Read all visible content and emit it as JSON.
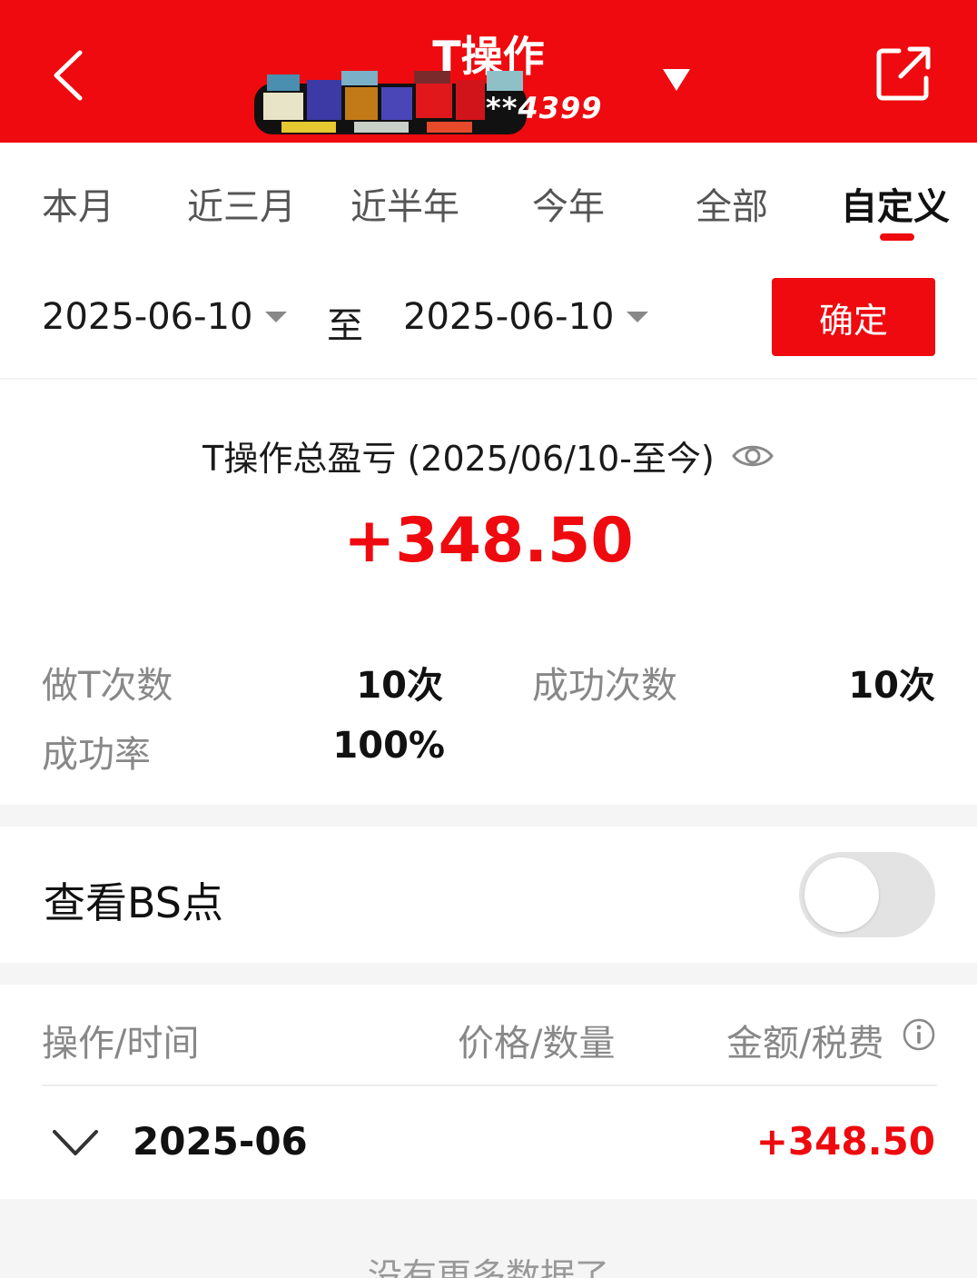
{
  "header": {
    "title": "T操作",
    "account_masked": "**4399"
  },
  "colors": {
    "brand_red": "#ee0a0f",
    "label_gray": "#888888"
  },
  "tabs": [
    {
      "label": "本月",
      "active": false
    },
    {
      "label": "近三月",
      "active": false
    },
    {
      "label": "近半年",
      "active": false
    },
    {
      "label": "今年",
      "active": false
    },
    {
      "label": "全部",
      "active": false
    },
    {
      "label": "自定义",
      "active": true
    }
  ],
  "date_range": {
    "start": "2025-06-10",
    "to_label": "至",
    "end": "2025-06-10",
    "confirm_label": "确定"
  },
  "summary": {
    "title": "T操作总盈亏 (2025/06/10-至今)",
    "total": "+348.50",
    "stats": {
      "trades_label": "做T次数",
      "trades_value": "10次",
      "success_label": "成功次数",
      "success_value": "10次",
      "rate_label": "成功率",
      "rate_value": "100%"
    }
  },
  "bs_points": {
    "label": "查看BS点",
    "enabled": false
  },
  "table": {
    "headers": [
      "操作/时间",
      "价格/数量",
      "金额/税费"
    ],
    "rows": [
      {
        "month": "2025-06",
        "value": "+348.50"
      }
    ],
    "footer": "没有更多数据了"
  },
  "icons": {
    "back": "back-arrow-icon",
    "share": "share-icon",
    "caret": "caret-down-icon",
    "eye": "eye-icon",
    "info": "info-icon",
    "chevron": "chevron-down-icon"
  }
}
